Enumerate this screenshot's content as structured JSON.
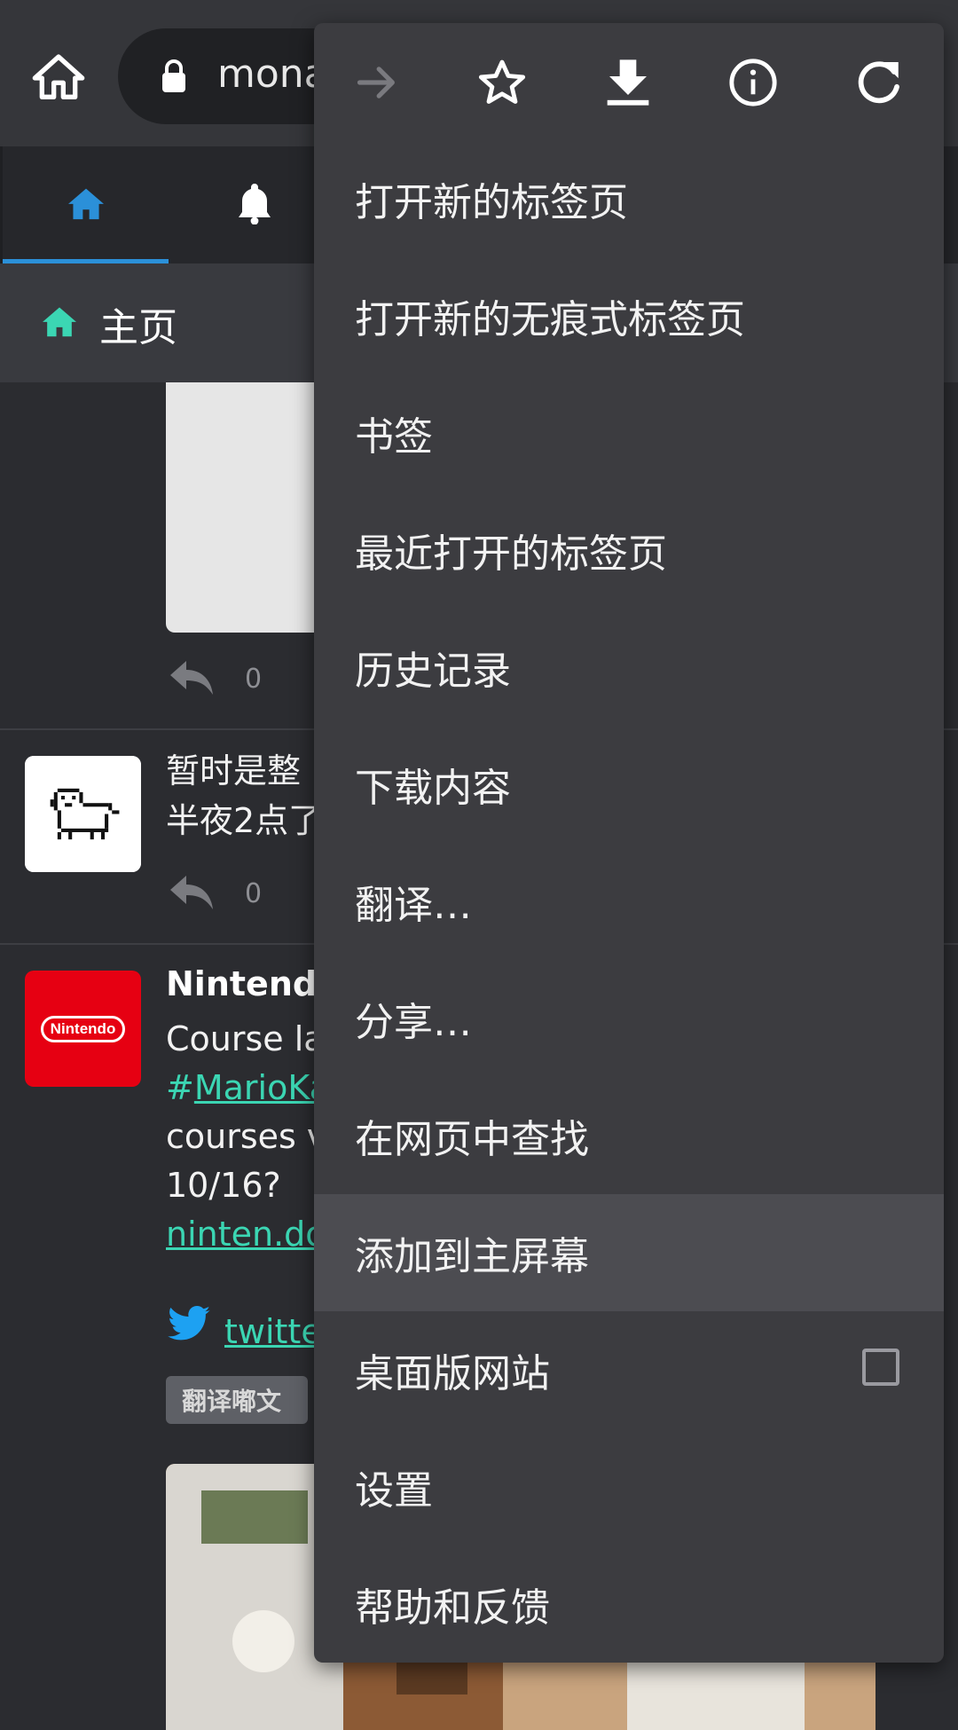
{
  "browser": {
    "url_visible": "mona",
    "icons": [
      "home-icon",
      "lock-icon"
    ]
  },
  "app": {
    "nav_tabs": [
      {
        "icon": "home-icon",
        "active": true
      },
      {
        "icon": "bell-icon",
        "active": false
      }
    ],
    "column_title": "主页",
    "accent_color": "#3bd6b3",
    "tab_active_color": "#2b90d9"
  },
  "feed": {
    "posts": [
      {
        "reply_count": "0"
      },
      {
        "text_line1": "暂时是整",
        "text_line2": "半夜2点了",
        "reply_count": "0",
        "avatar": "pixel-dog-avatar"
      },
      {
        "name": "Nintendo",
        "line1": "Course la",
        "hashtag_prefix": "#",
        "hashtag": "MarioKa",
        "line3": "courses v",
        "line4": "10/16?",
        "link": "ninten.do",
        "twitter_link": "twitte",
        "translate_label": "翻译嘟文",
        "avatar_label": "Nintendo"
      }
    ]
  },
  "menu": {
    "icon_row": [
      "forward-icon",
      "star-icon",
      "download-icon",
      "info-icon",
      "refresh-icon"
    ],
    "items": [
      {
        "label": "打开新的标签页"
      },
      {
        "label": "打开新的无痕式标签页"
      },
      {
        "label": "书签"
      },
      {
        "label": "最近打开的标签页"
      },
      {
        "label": "历史记录"
      },
      {
        "label": "下载内容"
      },
      {
        "label": "翻译…"
      },
      {
        "label": "分享…"
      },
      {
        "label": "在网页中查找"
      },
      {
        "label": "添加到主屏幕"
      },
      {
        "label": "桌面版网站",
        "checkbox": false
      },
      {
        "label": "设置"
      },
      {
        "label": "帮助和反馈"
      }
    ]
  }
}
